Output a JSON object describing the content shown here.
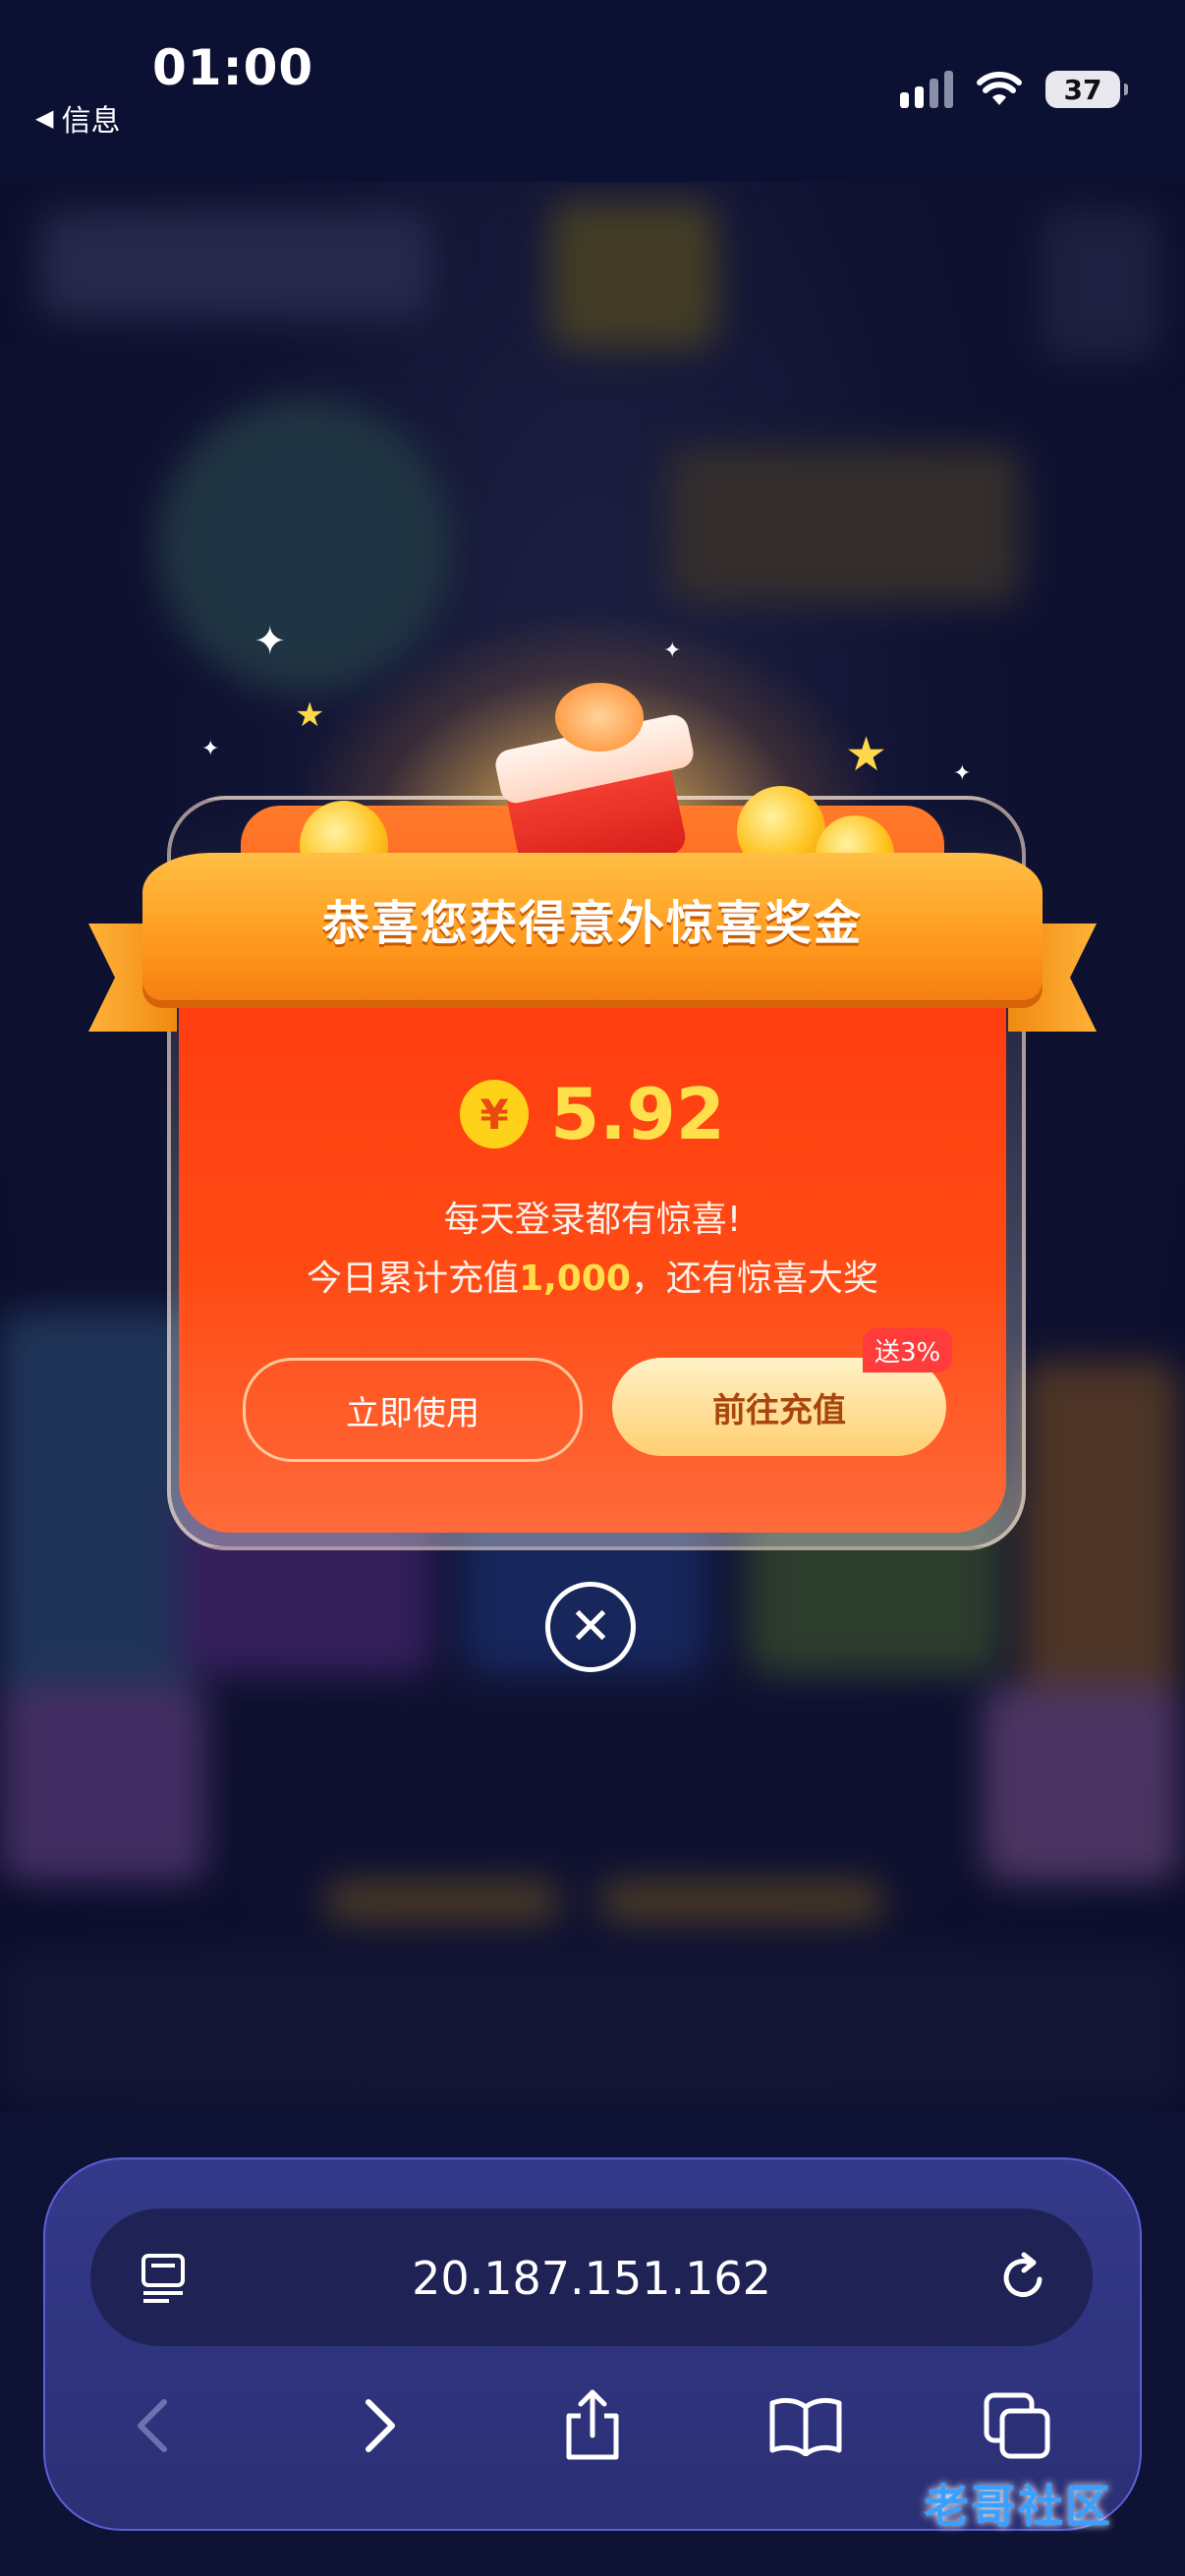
{
  "status_bar": {
    "time": "01:00",
    "back_label": "信息",
    "battery": "37"
  },
  "popup": {
    "title": "恭喜您获得意外惊喜奖金",
    "currency_symbol": "¥",
    "amount": "5.92",
    "line1": "每天登录都有惊喜!",
    "line2_prefix": "今日累计充值",
    "line2_highlight": "1,000",
    "line2_suffix": "，还有惊喜大奖",
    "use_button": "立即使用",
    "recharge_button": "前往充值",
    "bonus_badge": "送3%"
  },
  "browser": {
    "url": "20.187.151.162"
  },
  "watermark": "老哥社区",
  "icons": [
    "reader-icon",
    "reload-icon",
    "back-arrow-icon",
    "forward-arrow-icon",
    "share-icon",
    "bookmarks-icon",
    "tabs-icon",
    "close-icon",
    "wifi-icon",
    "signal-icon",
    "battery-icon"
  ],
  "colors": {
    "popup_red": "#ff3a10",
    "ribbon_orange": "#ff9a1e",
    "amount_yellow": "#ffe04a",
    "toolbar": "#2b2f74"
  }
}
